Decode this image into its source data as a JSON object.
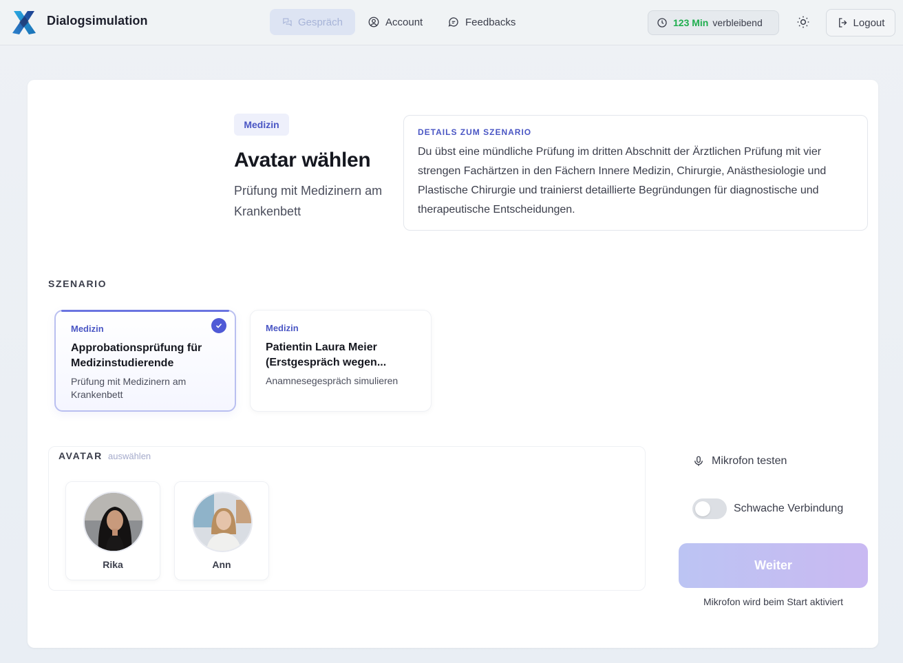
{
  "header": {
    "app_title": "Dialogsimulation",
    "nav": [
      {
        "label": "Gespräch",
        "icon": "chat-icon",
        "active": true
      },
      {
        "label": "Account",
        "icon": "user-circle-icon",
        "active": false
      },
      {
        "label": "Feedbacks",
        "icon": "feedback-icon",
        "active": false
      }
    ],
    "minutes": {
      "value": "123 Min",
      "suffix": "verbleibend"
    },
    "logout_label": "Logout"
  },
  "intro": {
    "category_badge": "Medizin",
    "title": "Avatar wählen",
    "subtitle": "Prüfung mit Medizinern am Krankenbett",
    "details_label": "DETAILS ZUM SZENARIO",
    "details_text": "Du übst eine mündliche Prüfung im dritten Abschnitt der Ärztlichen Prüfung mit vier strengen Fachärtzen in den Fächern Innere Medizin, Chirurgie, Anästhesiologie und Plastische Chirurgie und trainierst detaillierte Begründungen für diagnostische und therapeutische Entscheidungen."
  },
  "scenario": {
    "label": "SZENARIO",
    "cards": [
      {
        "category": "Medizin",
        "title": "Approbationsprüfung für Medizinstudierende",
        "description": "Prüfung mit Medizinern am Krankenbett",
        "selected": true
      },
      {
        "category": "Medizin",
        "title": "Patientin Laura Meier (Erstgespräch wegen...",
        "description": "Anamnesegespräch simulieren",
        "selected": false
      }
    ]
  },
  "avatar": {
    "label": "AVATAR",
    "hint": "auswählen",
    "items": [
      {
        "name": "Rika"
      },
      {
        "name": "Ann"
      }
    ]
  },
  "controls": {
    "mic_test_label": "Mikrofon testen",
    "weak_connection_label": "Schwache Verbindung",
    "weak_connection_on": false,
    "continue_label": "Weiter",
    "mic_note": "Mikrofon wird beim Start aktiviert"
  },
  "colors": {
    "accent": "#4f5ad6",
    "minutes_green": "#1fae4e",
    "continue_gradient_start": "#bcc4f3",
    "continue_gradient_end": "#c9b9f2"
  }
}
